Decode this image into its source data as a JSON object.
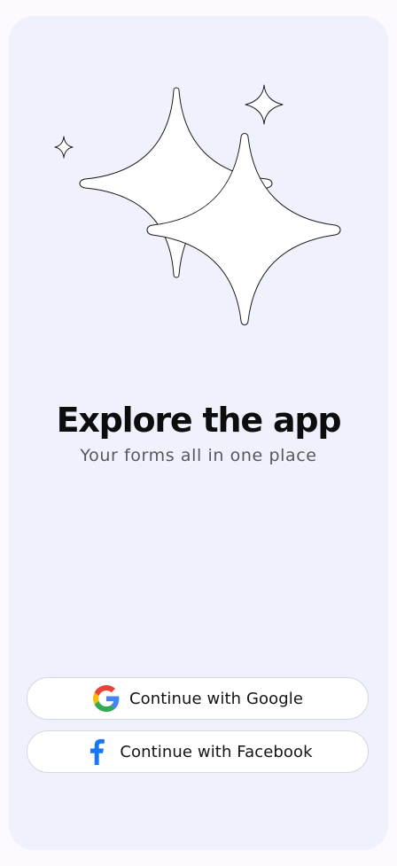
{
  "hero": {
    "title": "Explore the app",
    "subtitle": "Your forms all in one place",
    "illustration": "sparkles-illustration"
  },
  "auth": {
    "google_label": "Continue with Google",
    "google_icon": "google-icon",
    "facebook_label": "Continue with Facebook",
    "facebook_icon": "facebook-icon"
  },
  "colors": {
    "page_background": "#fdfaff",
    "card_background": "#eff2fc",
    "title": "#0d0d0d",
    "subtitle": "#57575c",
    "google_blue": "#4285f4",
    "google_red": "#ea4335",
    "google_yellow": "#fbbc05",
    "google_green": "#34a853",
    "facebook_blue": "#1877f2"
  }
}
